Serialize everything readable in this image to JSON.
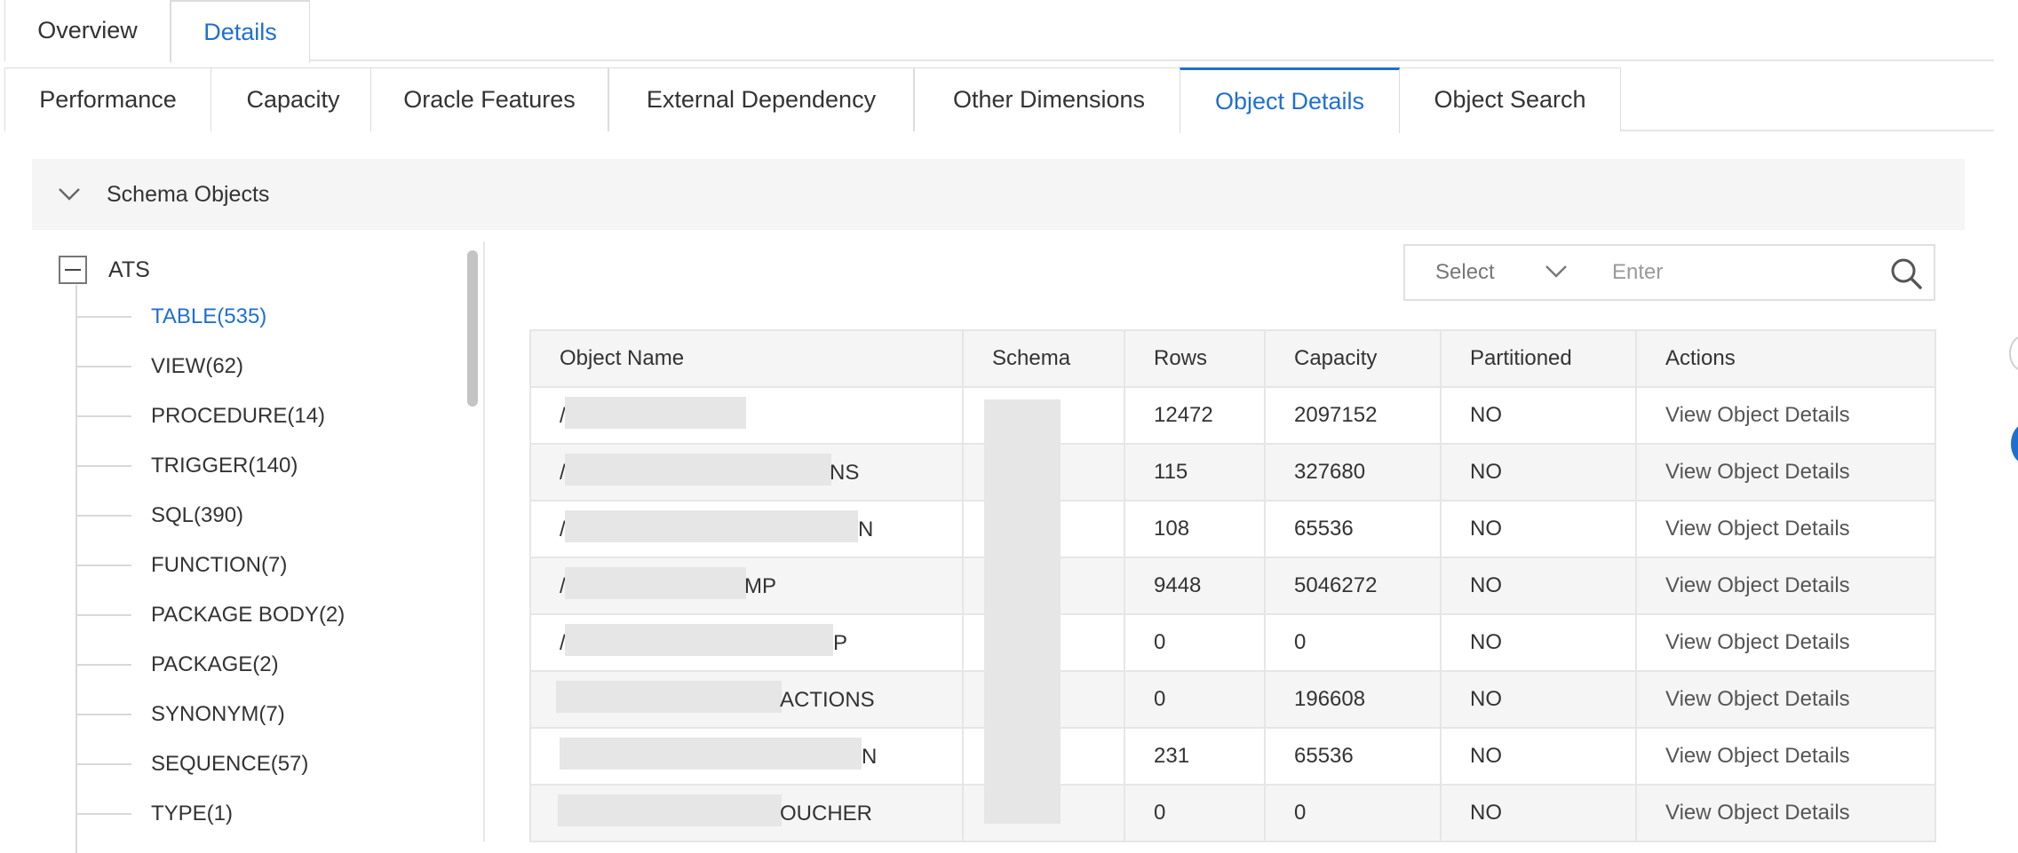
{
  "top_tabs": [
    {
      "label": "Overview",
      "active": false
    },
    {
      "label": "Details",
      "active": true
    }
  ],
  "sub_tabs": [
    {
      "label": "Performance",
      "active": false
    },
    {
      "label": "Capacity",
      "active": false
    },
    {
      "label": "Oracle Features",
      "active": false
    },
    {
      "label": "External Dependency",
      "active": false
    },
    {
      "label": "Other Dimensions",
      "active": false
    },
    {
      "label": "Object Details",
      "active": true
    },
    {
      "label": "Object Search",
      "active": false
    }
  ],
  "collapse": {
    "title": "Schema Objects",
    "icon": "chevron-down-icon"
  },
  "tree": {
    "root": "ATS",
    "items": [
      {
        "label": "TABLE(535)",
        "selected": true
      },
      {
        "label": "VIEW(62)",
        "selected": false
      },
      {
        "label": "PROCEDURE(14)",
        "selected": false
      },
      {
        "label": "TRIGGER(140)",
        "selected": false
      },
      {
        "label": "SQL(390)",
        "selected": false
      },
      {
        "label": "FUNCTION(7)",
        "selected": false
      },
      {
        "label": "PACKAGE BODY(2)",
        "selected": false
      },
      {
        "label": "PACKAGE(2)",
        "selected": false
      },
      {
        "label": "SYNONYM(7)",
        "selected": false
      },
      {
        "label": "SEQUENCE(57)",
        "selected": false
      },
      {
        "label": "TYPE(1)",
        "selected": false
      }
    ]
  },
  "filter": {
    "select_placeholder": "Select",
    "input_placeholder": "Enter",
    "search_icon": "search-icon"
  },
  "table": {
    "columns": [
      "Object Name",
      "Schema",
      "Rows",
      "Capacity",
      "Partitioned",
      "Actions"
    ],
    "rows": [
      {
        "name_prefix": "/",
        "name_suffix": "",
        "rows": "12472",
        "capacity": "2097152",
        "partitioned": "NO",
        "action": "View Object Details"
      },
      {
        "name_prefix": "/",
        "name_suffix": "NS",
        "rows": "115",
        "capacity": "327680",
        "partitioned": "NO",
        "action": "View Object Details"
      },
      {
        "name_prefix": "/",
        "name_suffix": "N",
        "rows": "108",
        "capacity": "65536",
        "partitioned": "NO",
        "action": "View Object Details"
      },
      {
        "name_prefix": "/",
        "name_suffix": "MP",
        "rows": "9448",
        "capacity": "5046272",
        "partitioned": "NO",
        "action": "View Object Details"
      },
      {
        "name_prefix": "/",
        "name_suffix": "P",
        "rows": "0",
        "capacity": "0",
        "partitioned": "NO",
        "action": "View Object Details"
      },
      {
        "name_prefix": "",
        "name_suffix": "ACTIONS",
        "rows": "0",
        "capacity": "196608",
        "partitioned": "NO",
        "action": "View Object Details"
      },
      {
        "name_prefix": "",
        "name_suffix": "N",
        "rows": "231",
        "capacity": "65536",
        "partitioned": "NO",
        "action": "View Object Details"
      },
      {
        "name_prefix": "",
        "name_suffix": "OUCHER",
        "rows": "0",
        "capacity": "0",
        "partitioned": "NO",
        "action": "View Object Details"
      }
    ]
  },
  "colors": {
    "accent": "#1f6fd1",
    "border": "#e6e6e6",
    "header_bg": "#f5f5f5",
    "text": "#333333"
  }
}
